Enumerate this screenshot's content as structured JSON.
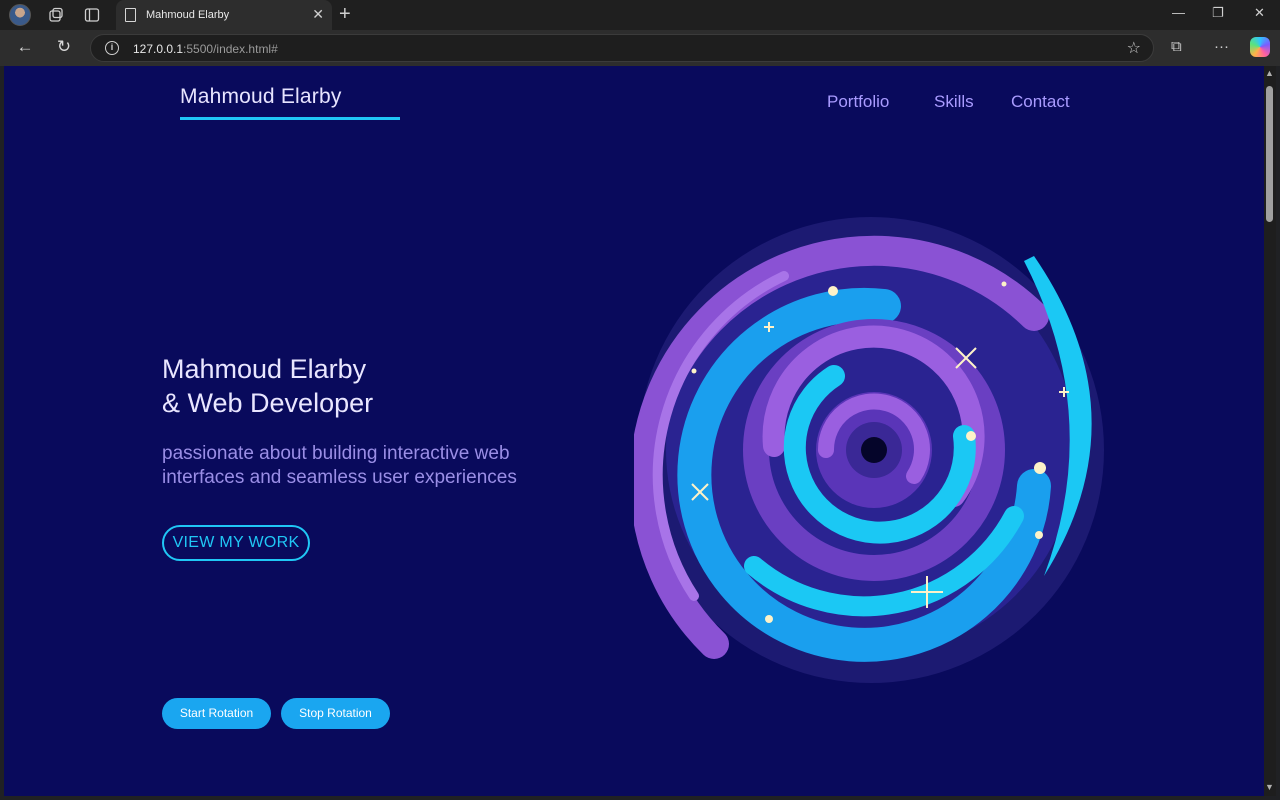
{
  "browser": {
    "tab_title": "Mahmoud Elarby",
    "url_host": "127.0.0.1",
    "url_rest": ":5500/index.html#"
  },
  "site": {
    "brand": "Mahmoud Elarby",
    "nav": [
      "Portfolio",
      "Skills",
      "Contact"
    ],
    "hero_line1": "Mahmoud Elarby",
    "hero_line2": "& Web Developer",
    "hero_subtitle": "passionate about building interactive web interfaces and seamless user experiences",
    "cta_label": "VIEW MY WORK",
    "start_label": "Start Rotation",
    "stop_label": "Stop Rotation"
  },
  "colors": {
    "page_bg": "#090a5c",
    "accent": "#20c7f5",
    "nav_link": "#a99bff",
    "button": "#1aa6f0"
  },
  "icons": [
    "profile-avatar",
    "workspaces-icon",
    "tab-actions-icon",
    "page-icon",
    "close-icon",
    "plus-icon",
    "back-icon",
    "reload-icon",
    "info-icon",
    "star-icon",
    "extensions-icon",
    "more-icon",
    "copilot-icon",
    "galaxy-illustration"
  ]
}
